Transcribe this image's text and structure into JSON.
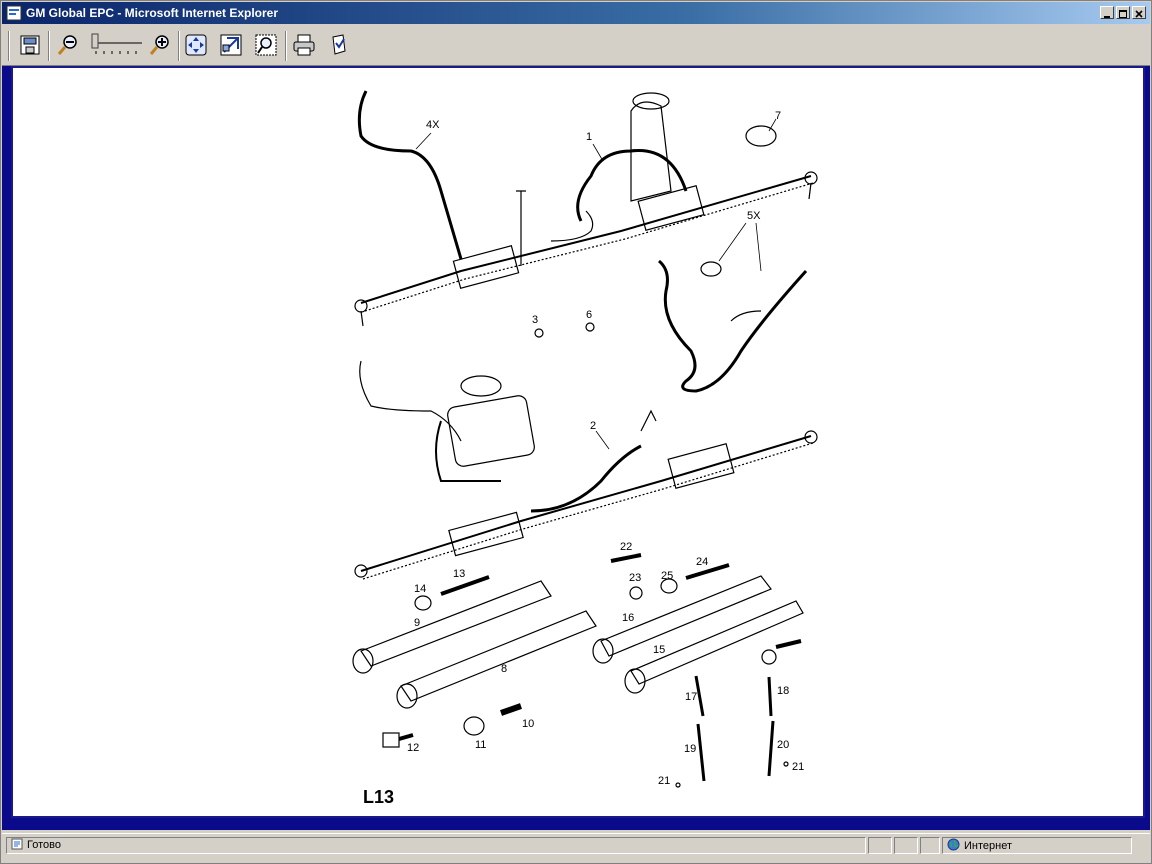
{
  "window": {
    "title": "GM Global EPC - Microsoft Internet Explorer"
  },
  "toolbar": {
    "buttons": [
      "save-icon",
      "zoom-out-icon",
      "zoom-in-icon",
      "fit-page-icon",
      "zoom-area-icon",
      "zoom-window-icon",
      "print-icon",
      "bookmark-icon"
    ]
  },
  "diagram": {
    "model_code": "L13",
    "callouts": {
      "c1": "1",
      "c2": "2",
      "c3": "3",
      "c4x": "4X",
      "c5x": "5X",
      "c6": "6",
      "c7": "7",
      "c8": "8",
      "c9": "9",
      "c10": "10",
      "c11": "11",
      "c12": "12",
      "c13": "13",
      "c14": "14",
      "c15": "15",
      "c16": "16",
      "c17": "17",
      "c18": "18",
      "c19": "19",
      "c20": "20",
      "c21a": "21",
      "c21b": "21",
      "c22": "22",
      "c23": "23",
      "c24": "24",
      "c25": "25"
    }
  },
  "status": {
    "text": "Готово",
    "zone": "Интернет"
  }
}
